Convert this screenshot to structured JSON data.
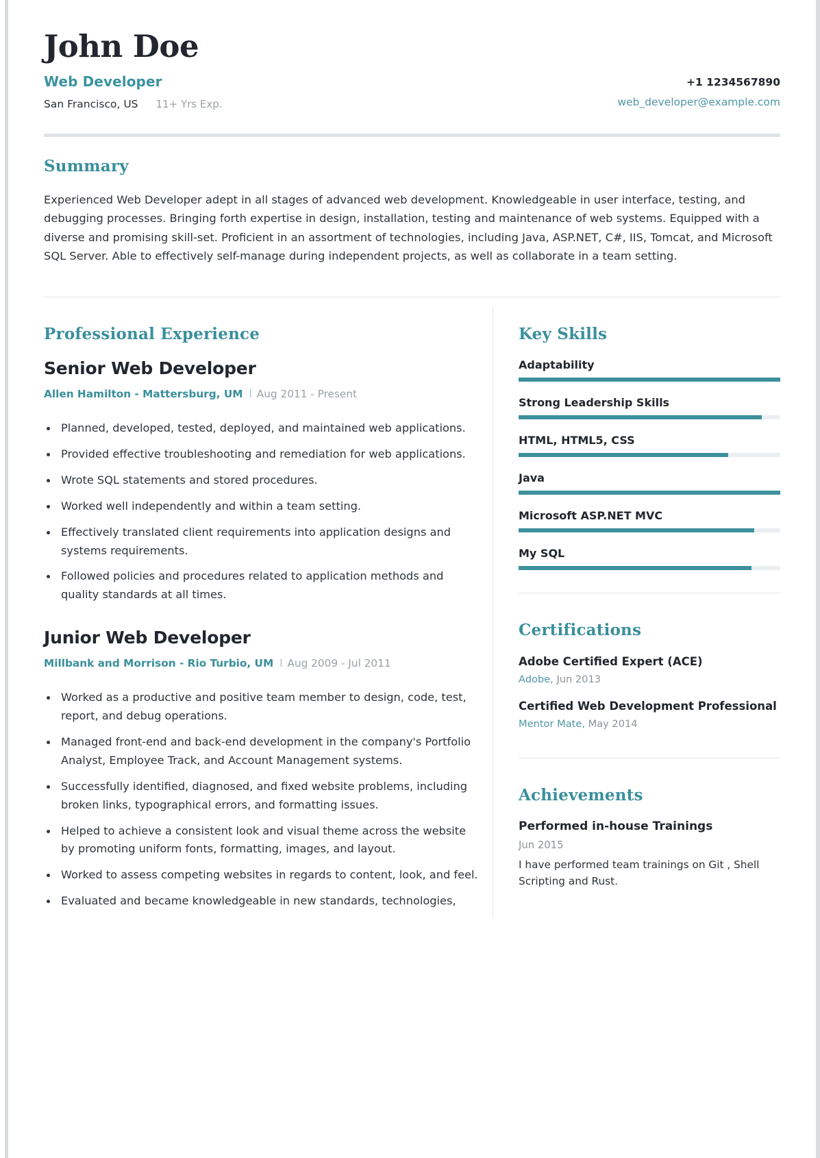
{
  "header": {
    "name": "John Doe",
    "role": "Web Developer",
    "location": "San Francisco, US",
    "experience": "11+ Yrs Exp.",
    "phone": "+1 1234567890",
    "email": "web_developer@example.com"
  },
  "summary": {
    "title": "Summary",
    "text": "Experienced Web Developer adept in all stages of advanced web development. Knowledgeable in user interface, testing, and debugging processes. Bringing forth expertise in design, installation, testing and maintenance of web systems. Equipped with a diverse and promising skill-set. Proficient in an assortment of technologies, including Java, ASP.NET, C#, IIS, Tomcat, and Microsoft SQL Server. Able to effectively self-manage during independent projects, as well as collaborate in a team setting."
  },
  "experience": {
    "title": "Professional Experience",
    "jobs": [
      {
        "title": "Senior Web Developer",
        "company": "Allen Hamilton - Mattersburg, UM",
        "separator": "l",
        "dates": "Aug 2011 - Present",
        "bullets": [
          "Planned, developed, tested, deployed, and maintained web applications.",
          "Provided effective troubleshooting and remediation for web applications.",
          "Wrote SQL statements and stored procedures.",
          "Worked well independently and within a team setting.",
          "Effectively translated client requirements into application designs and systems requirements.",
          "Followed policies and procedures related to application methods and quality standards at all times."
        ]
      },
      {
        "title": "Junior Web Developer",
        "company": "Millbank and Morrison - Rio Turbio, UM",
        "separator": "l",
        "dates": "Aug 2009 - Jul 2011",
        "bullets": [
          "Worked as a productive and positive team member to design, code, test, report, and debug operations.",
          "Managed front-end and back-end development in the company's Portfolio Analyst, Employee Track, and Account Management systems.",
          "Successfully identified, diagnosed, and fixed website problems, including broken links, typographical errors, and formatting issues.",
          "Helped to achieve a consistent look and visual theme across the website by promoting uniform fonts, formatting, images, and layout.",
          "Worked to assess competing websites in regards to content, look, and feel.",
          "Evaluated and became knowledgeable in new standards, technologies,"
        ]
      }
    ]
  },
  "skills": {
    "title": "Key Skills",
    "items": [
      {
        "name": "Adaptability",
        "level": 100
      },
      {
        "name": "Strong Leadership Skills",
        "level": 93
      },
      {
        "name": "HTML, HTML5, CSS",
        "level": 80
      },
      {
        "name": "Java",
        "level": 100
      },
      {
        "name": "Microsoft ASP.NET MVC",
        "level": 90
      },
      {
        "name": "My SQL",
        "level": 89
      }
    ]
  },
  "certifications": {
    "title": "Certifications",
    "items": [
      {
        "name": "Adobe Certified Expert (ACE)",
        "issuer": "Adobe,",
        "date": "Jun 2013"
      },
      {
        "name": "Certified Web Development Professional",
        "issuer": "Mentor Mate,",
        "date": "May 2014"
      }
    ]
  },
  "achievements": {
    "title": "Achievements",
    "items": [
      {
        "name": "Performed in-house Trainings",
        "date": "Jun 2015",
        "description": "I have performed team trainings on Git , Shell Scripting and Rust."
      }
    ]
  },
  "colors": {
    "accent": "#3a8f9c",
    "accent_link": "#4e97a3",
    "heading": "#22262e",
    "muted": "#9aa0a6",
    "track": "#eceff1"
  }
}
